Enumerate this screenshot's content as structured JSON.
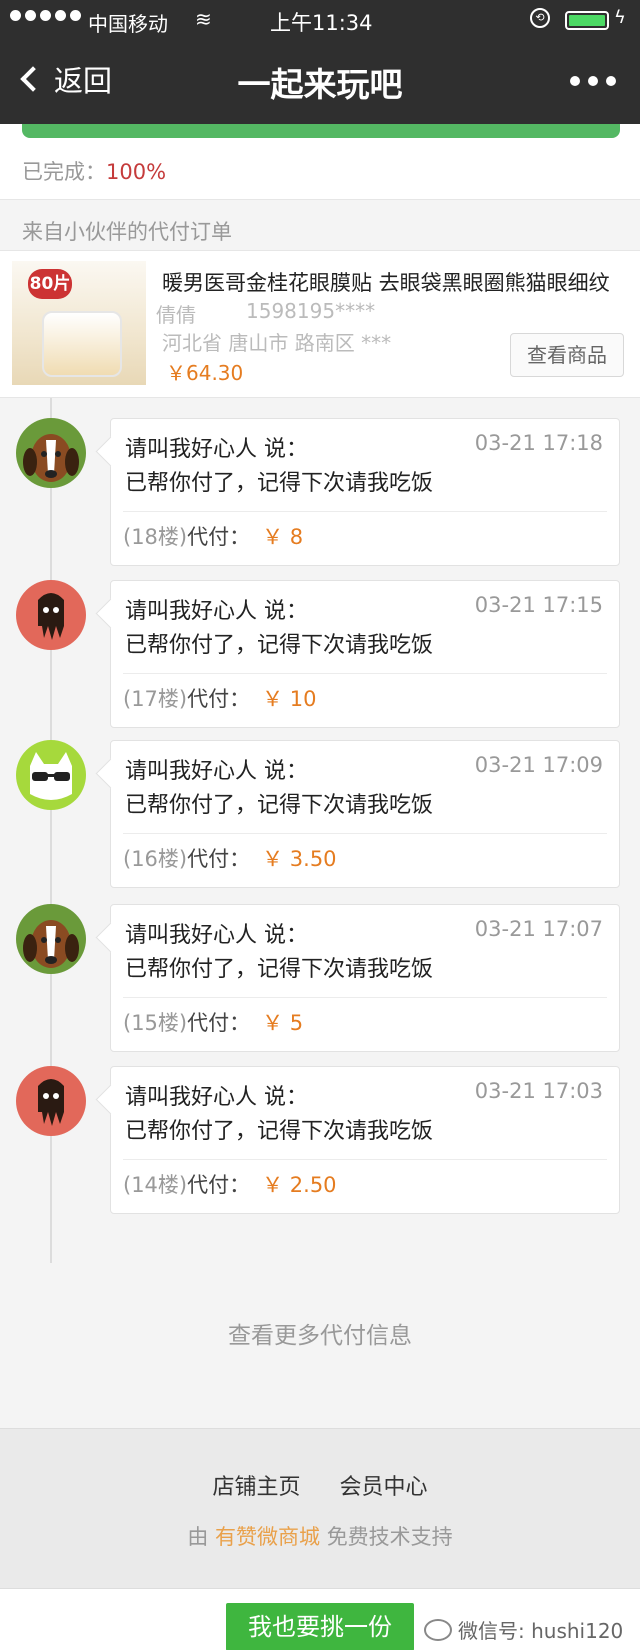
{
  "status_bar": {
    "carrier": "中国移动",
    "time": "上午11:34"
  },
  "nav": {
    "back_label": "返回",
    "title": "一起来玩吧"
  },
  "progress": {
    "label": "已完成：",
    "percent_text": "100%",
    "fill_fraction": 1.0
  },
  "section_label": "来自小伙伴的代付订单",
  "order": {
    "badge": "80片",
    "title": "暖男医哥金桂花眼膜贴 去眼袋黑眼圈熊猫眼细纹",
    "buyer": "倩倩",
    "phone": "1598195****",
    "address": "河北省 唐山市 路南区 ***",
    "price": "￥64.30",
    "view_button": "查看商品"
  },
  "entries": [
    {
      "name": "请叫我好心人 说：",
      "time": "03-21 17:18",
      "message": "已帮你付了，记得下次请我吃饭",
      "floor": "(18楼)",
      "pay_label": "代付：",
      "amount": "￥ 8",
      "avatar": "beagle-icon"
    },
    {
      "name": "请叫我好心人 说：",
      "time": "03-21 17:15",
      "message": "已帮你付了，记得下次请我吃饭",
      "floor": "(17楼)",
      "pay_label": "代付：",
      "amount": "￥ 10",
      "avatar": "squid-icon"
    },
    {
      "name": "请叫我好心人 说：",
      "time": "03-21 17:09",
      "message": "已帮你付了，记得下次请我吃饭",
      "floor": "(16楼)",
      "pay_label": "代付：",
      "amount": "￥ 3.50",
      "avatar": "cool-cat-icon"
    },
    {
      "name": "请叫我好心人 说：",
      "time": "03-21 17:07",
      "message": "已帮你付了，记得下次请我吃饭",
      "floor": "(15楼)",
      "pay_label": "代付：",
      "amount": "￥ 5",
      "avatar": "beagle-icon"
    },
    {
      "name": "请叫我好心人 说：",
      "time": "03-21 17:03",
      "message": "已帮你付了，记得下次请我吃饭",
      "floor": "(14楼)",
      "pay_label": "代付：",
      "amount": "￥ 2.50",
      "avatar": "squid-icon"
    }
  ],
  "more_link": "查看更多代付信息",
  "footer": {
    "link_store": "店铺主页",
    "link_member": "会员中心",
    "support_prefix": "由",
    "support_brand": "有赞微商城",
    "support_suffix": "免费技术支持"
  },
  "bottom": {
    "cta": "我也要挑一份",
    "watermark": "微信号: hushi120"
  },
  "colors": {
    "accent_green": "#3fb63f",
    "price_orange": "#e57c20",
    "percent_red": "#c53b3b"
  }
}
